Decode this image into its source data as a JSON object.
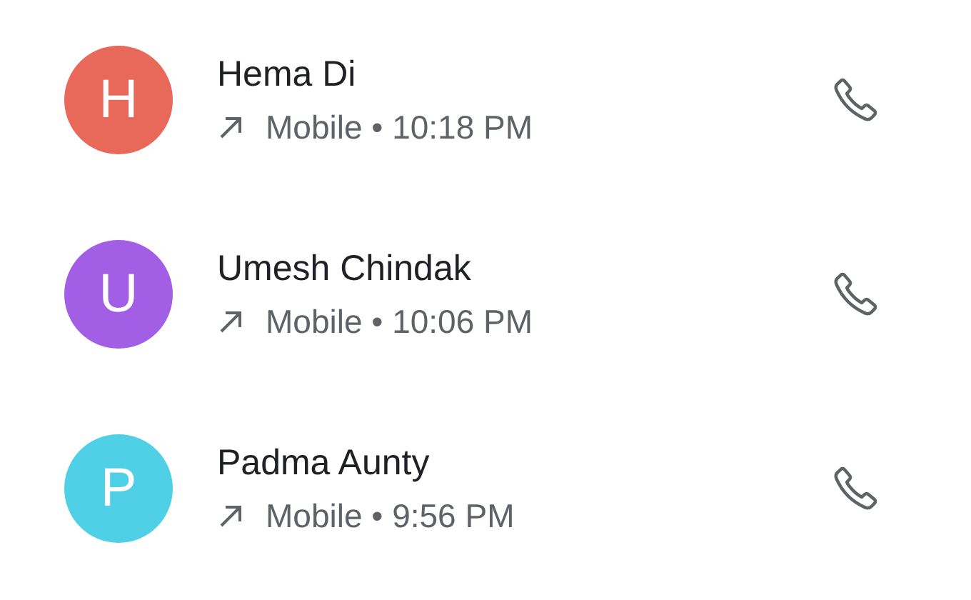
{
  "calls": [
    {
      "initial": "H",
      "name": "Hema Di",
      "kind": "outgoing",
      "detail": "Mobile • 10:18 PM",
      "color": "#e8685a"
    },
    {
      "initial": "U",
      "name": "Umesh Chindak",
      "kind": "outgoing",
      "detail": "Mobile • 10:06 PM",
      "color": "#a35ee6"
    },
    {
      "initial": "P",
      "name": "Padma Aunty",
      "kind": "outgoing",
      "detail": "Mobile • 9:56 PM",
      "color": "#4fd0e6"
    }
  ]
}
